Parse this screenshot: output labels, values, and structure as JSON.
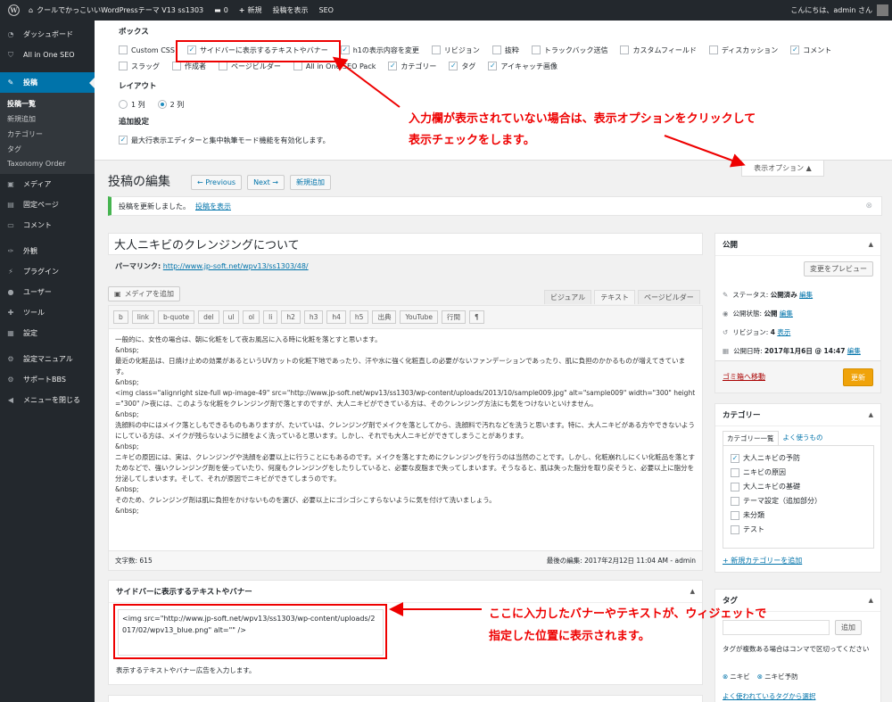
{
  "adminbar": {
    "site": "クールでかっこいいWordPressテーマ V13 ss1303",
    "comments": "0",
    "new": "新規",
    "view": "投稿を表示",
    "seo": "SEO",
    "greeting": "こんにちは、admin さん"
  },
  "sidebar": {
    "items": [
      {
        "label": "ダッシュボード",
        "icon": "dashboard-icon",
        "glyph": "◔"
      },
      {
        "label": "All in One SEO",
        "icon": "shield-icon",
        "glyph": "⛉"
      },
      {
        "label": "投稿",
        "icon": "pin-icon",
        "glyph": "✎"
      },
      {
        "label": "メディア",
        "icon": "media-icon",
        "glyph": "▣"
      },
      {
        "label": "固定ページ",
        "icon": "page-icon",
        "glyph": "▤"
      },
      {
        "label": "コメント",
        "icon": "comment-icon",
        "glyph": "▭"
      },
      {
        "label": "外観",
        "icon": "brush-icon",
        "glyph": "✑"
      },
      {
        "label": "プラグイン",
        "icon": "plugin-icon",
        "glyph": "⚡"
      },
      {
        "label": "ユーザー",
        "icon": "user-icon",
        "glyph": "●"
      },
      {
        "label": "ツール",
        "icon": "wrench-icon",
        "glyph": "✚"
      },
      {
        "label": "設定",
        "icon": "settings-icon",
        "glyph": "▦"
      },
      {
        "label": "設定マニュアル",
        "icon": "gear-icon",
        "glyph": "⚙"
      },
      {
        "label": "サポートBBS",
        "icon": "gear-icon",
        "glyph": "⚙"
      },
      {
        "label": "メニューを閉じる",
        "icon": "collapse-icon",
        "glyph": "◀"
      }
    ],
    "sub": [
      "投稿一覧",
      "新規追加",
      "カテゴリー",
      "タグ",
      "Taxonomy Order"
    ]
  },
  "screen_options": {
    "boxes_title": "ボックス",
    "row1": [
      {
        "label": "Custom CSS",
        "checked": false
      },
      {
        "label": "サイドバーに表示するテキストやバナー",
        "checked": true
      },
      {
        "label": "h1の表示内容を変更",
        "checked": true
      },
      {
        "label": "リビジョン",
        "checked": false
      },
      {
        "label": "抜粋",
        "checked": false
      },
      {
        "label": "トラックバック送信",
        "checked": false
      },
      {
        "label": "カスタムフィールド",
        "checked": false
      },
      {
        "label": "ディスカッション",
        "checked": false
      },
      {
        "label": "コメント",
        "checked": true
      }
    ],
    "row2": [
      {
        "label": "スラッグ",
        "checked": false
      },
      {
        "label": "作成者",
        "checked": false
      },
      {
        "label": "ページビルダー",
        "checked": false
      },
      {
        "label": "All in One SEO Pack",
        "checked": false
      },
      {
        "label": "カテゴリー",
        "checked": true
      },
      {
        "label": "タグ",
        "checked": true
      },
      {
        "label": "アイキャッチ画像",
        "checked": true
      }
    ],
    "layout_title": "レイアウト",
    "col1": "1 列",
    "col2": "2 列",
    "extra_title": "追加設定",
    "extra_label": "最大行表示エディターと集中執筆モード機能を有効化します。",
    "tab": "表示オプション ▲"
  },
  "annotations": {
    "top_line1": "入力欄が表示されていない場合は、表示オプションをクリックして",
    "top_line2": "表示チェックをします。",
    "bottom_line1": "ここに入力したバナーやテキストが、ウィジェットで",
    "bottom_line2": "指定した位置に表示されます。"
  },
  "editor": {
    "page_title": "投稿の編集",
    "prev": "← Previous",
    "next": "Next →",
    "add_new": "新規追加",
    "notice": "投稿を更新しました。",
    "notice_link": "投稿を表示",
    "post_title": "大人ニキビのクレンジングについて",
    "permalink_label": "パーマリンク:",
    "permalink": "http://www.jp-soft.net/wpv13/ss1303/48/",
    "add_media": "メディアを追加",
    "tabs": [
      "ビジュアル",
      "テキスト",
      "ページビルダー"
    ],
    "quicktags": [
      "b",
      "link",
      "b-quote",
      "del",
      "ul",
      "ol",
      "li",
      "h2",
      "h3",
      "h4",
      "h5",
      "出典",
      "YouTube",
      "行間",
      "¶"
    ],
    "content": [
      "一般的に、女性の場合は、朝に化粧をして夜お風呂に入る時に化粧を落とすと思います。",
      "&nbsp;",
      "最近の化粧品は、日焼け止めの効果があるというUVカットの化粧下地であったり、汗や水に強く化粧直しの必要がないファンデーションであったり、肌に負担のかかるものが増えてきています。",
      "&nbsp;",
      "<img class=\"alignright size-full wp-image-49\" src=\"http://www.jp-soft.net/wpv13/ss1303/wp-content/uploads/2013/10/sample009.jpg\" alt=\"sample009\" width=\"300\" height=\"300\" />夜には、このような化粧をクレンジング剤で落とすのですが、大人ニキビができている方は、そのクレンジング方法にも気をつけないといけません。",
      "&nbsp;",
      "洗顔料の中にはメイク落としもできるものもありますが、たいていは、クレンジング剤でメイクを落としてから、洗顔料で汚れなどを洗うと思います。特に、大人ニキビがある方やできないようにしている方は、メイクが残らないように顔をよく洗っていると思います。しかし、それでも大人ニキビができてしまうことがあります。",
      "&nbsp;",
      "ニキビの原因には、実は、クレンジングや洗顔を必要以上に行うことにもあるのです。メイクを落とすためにクレンジングを行うのは当然のことです。しかし、化粧崩れしにくい化粧品を落とすためなどで、強いクレンジング剤を使っていたり、何度もクレンジングをしたりしていると、必要な皮脂まで失ってしまいます。そうなると、肌は失った脂分を取り戻そうと、必要以上に脂分を分泌してしまいます。そして、それが原因でニキビができてしまうのです。",
      "&nbsp;",
      "そのため、クレンジング剤は肌に負担をかけないものを選び、必要以上にゴシゴシこすらないように気を付けて洗いましょう。",
      "&nbsp;"
    ],
    "word_count": "文字数: 615",
    "last_edit": "最後の編集: 2017年2月12日 11:04 AM - admin"
  },
  "banner_box": {
    "title": "サイドバーに表示するテキストやバナー",
    "value": "<img src=\"http://www.jp-soft.net/wpv13/ss1303/wp-content/uploads/2017/02/wpv13_blue.png\" alt=\"\" />",
    "help": "表示するテキストやバナー広告を入力します。"
  },
  "publish": {
    "title": "公開",
    "preview": "変更をプレビュー",
    "status_label": "ステータス:",
    "status": "公開済み",
    "edit": "編集",
    "visibility_label": "公開状態:",
    "visibility": "公開",
    "revisions_label": "リビジョン:",
    "revisions": "4",
    "revisions_link": "表示",
    "date_label": "公開日時:",
    "date": "2017年1月6日 @ 14:47",
    "trash": "ゴミ箱へ移動",
    "update": "更新"
  },
  "categories": {
    "title": "カテゴリー",
    "tab_all": "カテゴリー一覧",
    "tab_pop": "よく使うもの",
    "items": [
      {
        "label": "大人ニキビの予防",
        "checked": true
      },
      {
        "label": "ニキビの原因",
        "checked": false
      },
      {
        "label": "大人ニキビの基礎",
        "checked": false
      },
      {
        "label": "テーマ設定（追加部分）",
        "checked": false
      },
      {
        "label": "未分類",
        "checked": false
      },
      {
        "label": "テスト",
        "checked": false
      }
    ],
    "add": "+ 新規カテゴリーを追加"
  },
  "tags": {
    "title": "タグ",
    "add": "追加",
    "hint": "タグが複数ある場合はコンマで区切ってください",
    "items": [
      "ニキビ",
      "ニキビ予防"
    ],
    "popular": "よく使われているタグから選択"
  }
}
